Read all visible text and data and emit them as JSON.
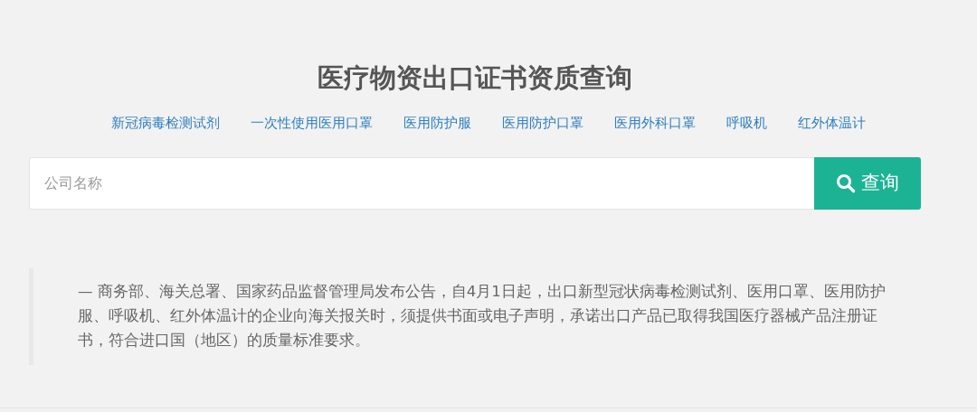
{
  "title": "医疗物资出口证书资质查询",
  "categories": [
    {
      "label": "新冠病毒检测试剂"
    },
    {
      "label": "一次性使用医用口罩"
    },
    {
      "label": "医用防护服"
    },
    {
      "label": "医用防护口罩"
    },
    {
      "label": "医用外科口罩"
    },
    {
      "label": "呼吸机"
    },
    {
      "label": "红外体温计"
    }
  ],
  "search": {
    "placeholder": "公司名称",
    "button": "查询"
  },
  "notice": "— 商务部、海关总署、国家药品监督管理局发布公告，自4月1日起，出口新型冠状病毒检测试剂、医用口罩、医用防护服、呼吸机、红外体温计的企业向海关报关时，须提供书面或电子声明，承诺出口产品已取得我国医疗器械产品注册证书，符合进口国（地区）的质量标准要求。"
}
